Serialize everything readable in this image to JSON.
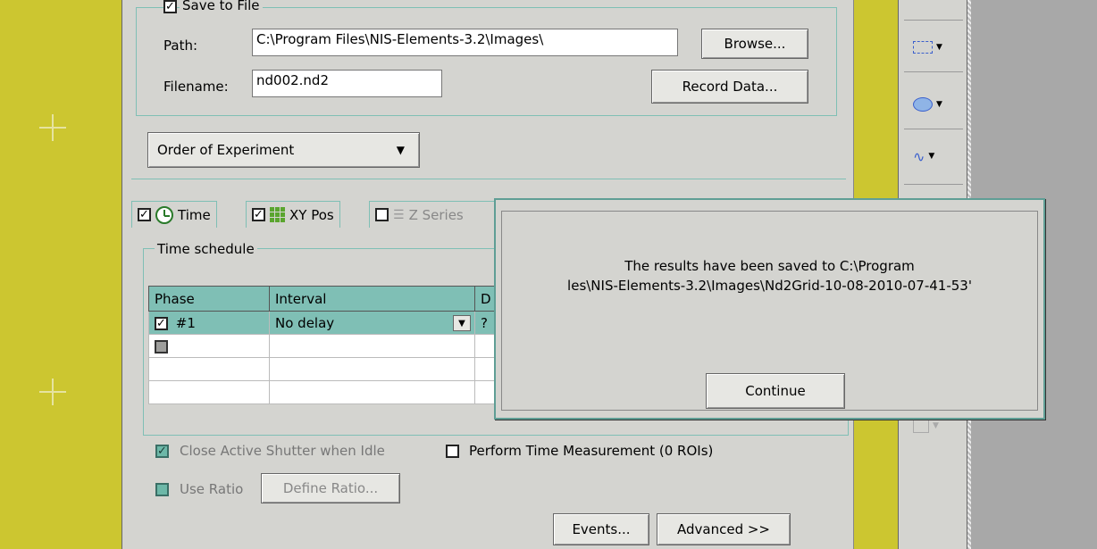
{
  "save_group": {
    "legend": "Save to File",
    "checked": true,
    "path_label": "Path:",
    "path_value": "C:\\Program Files\\NIS-Elements-3.2\\Images\\",
    "browse_label": "Browse...",
    "filename_label": "Filename:",
    "filename_value": "nd002.nd2",
    "record_label": "Record Data..."
  },
  "order_dropdown": {
    "value": "Order of Experiment"
  },
  "tabs": [
    {
      "label": "Time",
      "checked": true,
      "icon": "clock-icon"
    },
    {
      "label": "XY Pos",
      "checked": true,
      "icon": "grid-icon"
    },
    {
      "label": "Z Series",
      "checked": false,
      "icon": "z-stack-icon"
    }
  ],
  "time_schedule": {
    "legend": "Time schedule",
    "columns": [
      "Phase",
      "Interval",
      "D"
    ],
    "rows": [
      {
        "phase": "#1",
        "interval": "No delay",
        "duration": "?",
        "checked": true
      },
      {
        "phase": "",
        "interval": "",
        "duration": "",
        "checked": false
      }
    ]
  },
  "options": {
    "close_shutter": "Close Active Shutter when Idle",
    "perform_time": "Perform Time Measurement (0 ROIs)",
    "use_ratio": "Use Ratio",
    "define_ratio": "Define Ratio..."
  },
  "bottom_buttons": {
    "events": "Events...",
    "advanced": "Advanced >>"
  },
  "dialog": {
    "line1": "The results have been saved to C:\\Program",
    "line2": "les\\NIS-Elements-3.2\\Images\\Nd2Grid-10-08-2010-07-41-53'",
    "continue_label": "Continue"
  },
  "colors": {
    "background": "#ccc630",
    "teal": "#7fbfb5",
    "panel": "#d4d4d0"
  }
}
